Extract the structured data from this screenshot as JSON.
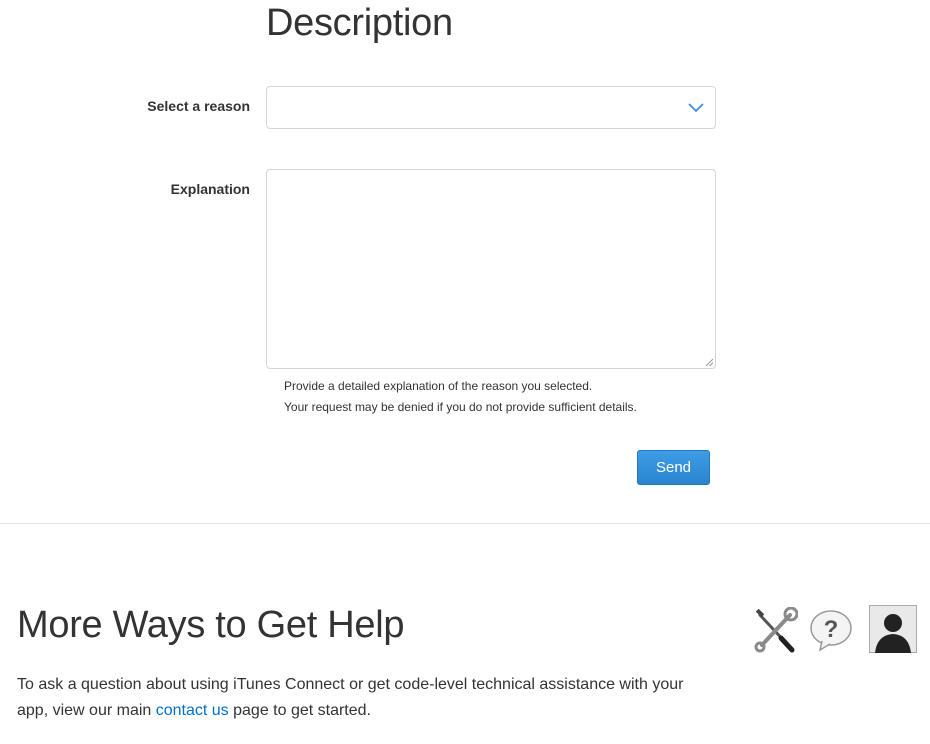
{
  "description": {
    "title": "Description",
    "reason_label": "Select a reason",
    "reason_value": "",
    "explanation_label": "Explanation",
    "explanation_value": "",
    "hint_line1": "Provide a detailed explanation of the reason you selected.",
    "hint_line2": "Your request may be denied if you do not provide sufficient details.",
    "send_label": "Send",
    "colors": {
      "accent": "#3d9de6",
      "link": "#0070c9",
      "chevron": "#2a8ae0"
    }
  },
  "help": {
    "title": "More Ways to Get Help",
    "text_before": "To ask a question about using iTunes Connect or get code-level technical assistance with your app, view our main ",
    "link_text": "contact us",
    "text_after": " page to get started.",
    "icons": [
      "tools-icon",
      "question-bubble-icon",
      "person-silhouette-icon"
    ]
  }
}
